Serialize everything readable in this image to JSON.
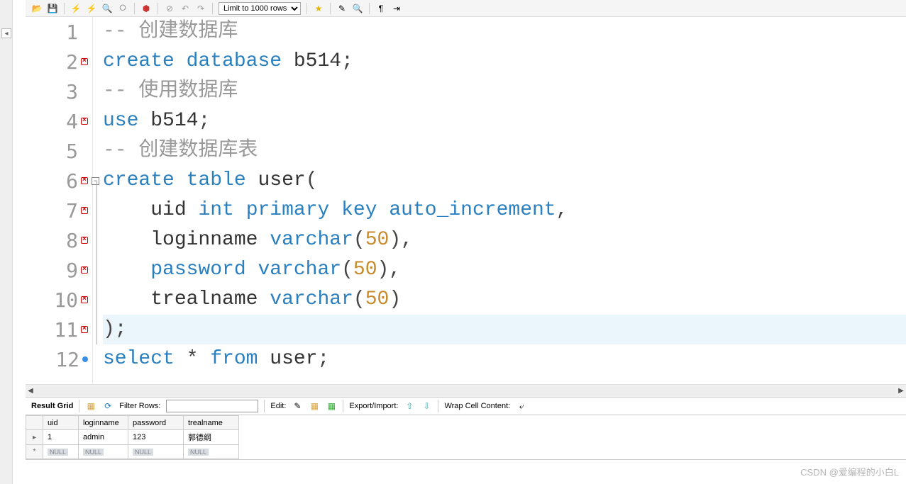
{
  "toolbar": {
    "limit_label": "Limit to 1000 rows"
  },
  "editor": {
    "lines": [
      {
        "n": 1,
        "marker": "",
        "segs": [
          [
            "cmnt",
            "-- 创建数据库"
          ]
        ]
      },
      {
        "n": 2,
        "marker": "err",
        "segs": [
          [
            "kw",
            "create"
          ],
          [
            "",
            ""
          ],
          [
            "kw",
            "database"
          ],
          [
            "",
            ""
          ],
          [
            "ident",
            "b514"
          ],
          [
            "punc",
            ";"
          ]
        ]
      },
      {
        "n": 3,
        "marker": "",
        "segs": [
          [
            "cmnt",
            "-- 使用数据库"
          ]
        ]
      },
      {
        "n": 4,
        "marker": "err",
        "segs": [
          [
            "kw",
            "use"
          ],
          [
            "",
            ""
          ],
          [
            "ident",
            "b514"
          ],
          [
            "punc",
            ";"
          ]
        ]
      },
      {
        "n": 5,
        "marker": "",
        "segs": [
          [
            "cmnt",
            "-- 创建数据库表"
          ]
        ]
      },
      {
        "n": 6,
        "marker": "err",
        "fold": true,
        "segs": [
          [
            "kw",
            "create"
          ],
          [
            "",
            ""
          ],
          [
            "kw",
            "table"
          ],
          [
            "",
            ""
          ],
          [
            "ident",
            "user"
          ],
          [
            "punc",
            "("
          ]
        ]
      },
      {
        "n": 7,
        "marker": "err",
        "indent": 1,
        "segs": [
          [
            "ident",
            "uid"
          ],
          [
            "",
            ""
          ],
          [
            "kw",
            "int"
          ],
          [
            "",
            ""
          ],
          [
            "kw",
            "primary"
          ],
          [
            "",
            ""
          ],
          [
            "kw",
            "key"
          ],
          [
            "",
            ""
          ],
          [
            "kw",
            "auto_increment"
          ],
          [
            "punc",
            ","
          ]
        ]
      },
      {
        "n": 8,
        "marker": "err",
        "indent": 1,
        "segs": [
          [
            "ident",
            "loginname"
          ],
          [
            "",
            ""
          ],
          [
            "kw",
            "varchar"
          ],
          [
            "punc",
            "("
          ],
          [
            "num",
            "50"
          ],
          [
            "punc",
            "),"
          ]
        ]
      },
      {
        "n": 9,
        "marker": "err",
        "indent": 1,
        "segs": [
          [
            "kw",
            "password"
          ],
          [
            "",
            ""
          ],
          [
            "kw",
            "varchar"
          ],
          [
            "punc",
            "("
          ],
          [
            "num",
            "50"
          ],
          [
            "punc",
            "),"
          ]
        ]
      },
      {
        "n": 10,
        "marker": "err",
        "indent": 1,
        "segs": [
          [
            "ident",
            "trealname"
          ],
          [
            "",
            ""
          ],
          [
            "kw",
            "varchar"
          ],
          [
            "punc",
            "("
          ],
          [
            "num",
            "50"
          ],
          [
            "punc",
            ")"
          ]
        ]
      },
      {
        "n": 11,
        "marker": "err",
        "hl": true,
        "segs": [
          [
            "punc",
            ");"
          ]
        ]
      },
      {
        "n": 12,
        "marker": "dot",
        "segs": [
          [
            "kw",
            "select"
          ],
          [
            "",
            ""
          ],
          [
            "punc",
            "*"
          ],
          [
            "",
            ""
          ],
          [
            "kw",
            "from"
          ],
          [
            "",
            ""
          ],
          [
            "ident",
            "user"
          ],
          [
            "punc",
            ";"
          ]
        ]
      }
    ]
  },
  "actionbar": {
    "result_grid": "Result Grid",
    "filter_label": "Filter Rows:",
    "filter_value": "",
    "edit": "Edit:",
    "export_import": "Export/Import:",
    "wrap": "Wrap Cell Content:"
  },
  "grid": {
    "headers": [
      "uid",
      "loginname",
      "password",
      "trealname"
    ],
    "rows": [
      {
        "hdr": "▸",
        "cells": [
          "1",
          "admin",
          "123",
          "郭德纲"
        ]
      },
      {
        "hdr": "*",
        "cells": [
          "NULL",
          "NULL",
          "NULL",
          "NULL"
        ],
        "null": true
      }
    ]
  },
  "watermark": "CSDN @爱编程的小白L"
}
